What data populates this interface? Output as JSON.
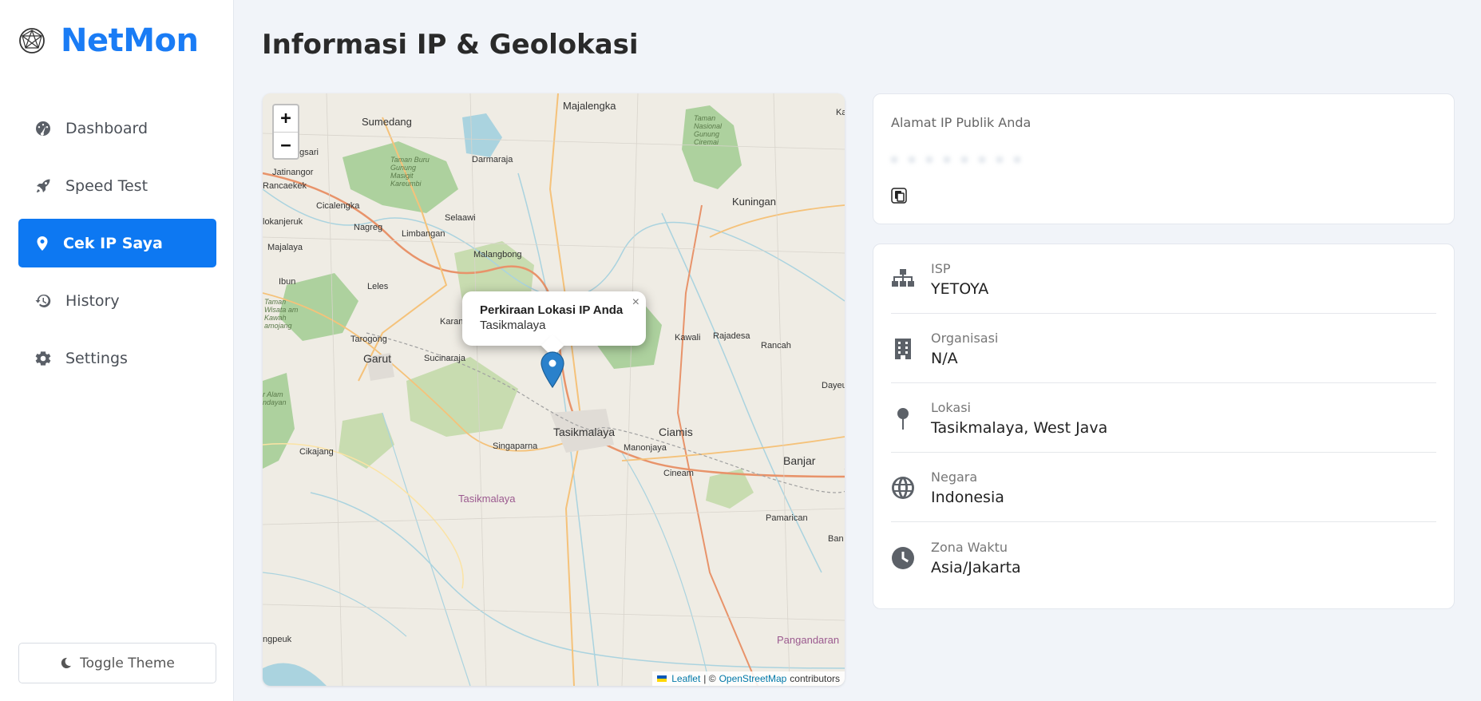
{
  "brand": {
    "name": "NetMon",
    "icon": "globe-network-icon",
    "accent": "#1a7cf5"
  },
  "sidebar": {
    "items": [
      {
        "label": "Dashboard",
        "icon": "gauge-icon",
        "active": false
      },
      {
        "label": "Speed Test",
        "icon": "rocket-icon",
        "active": false
      },
      {
        "label": "Cek IP Saya",
        "icon": "map-pin-icon",
        "active": true
      },
      {
        "label": "History",
        "icon": "history-icon",
        "active": false
      },
      {
        "label": "Settings",
        "icon": "gear-icon",
        "active": false
      }
    ],
    "toggle_label": "Toggle Theme",
    "active_color": "#0d78f2"
  },
  "page": {
    "title": "Informasi IP & Geolokasi"
  },
  "map": {
    "zoom_in": "+",
    "zoom_out": "−",
    "popup": {
      "title": "Perkiraan Lokasi IP Anda",
      "subtitle": "Tasikmalaya",
      "close": "×"
    },
    "attribution": {
      "leaflet": "Leaflet",
      "sep": "| ©",
      "osm": "OpenStreetMap",
      "suffix": "contributors"
    },
    "labels": {
      "majalengka": "Majalengka",
      "sumedang": "Sumedang",
      "darmaraja": "Darmaraja",
      "kuningan": "Kuningan",
      "taman_nasional": "Taman Nasional Gunung Ciremai",
      "taman_buru": "Taman Buru Gunung Masigit Kareumbi",
      "jatinangor": "Jatinangor",
      "rancaekek": "Rancaekek",
      "cicalengka": "Cicalengka",
      "nagreg": "Nagreg",
      "limbangan": "Limbangan",
      "selaawi": "Selaawi",
      "malangbong": "Malangbong",
      "lokanjeruk": "lokanjeruk",
      "majalaya": "Majalaya",
      "ibun": "Ibun",
      "leles": "Leles",
      "taman_wisata": "Taman Wisata am Kawah amojang",
      "tarogong": "Tarogong",
      "garut": "Garut",
      "sucinaraja": "Sucinaraja",
      "karan": "Karan",
      "kawali": "Kawali",
      "rajadesa": "Rajadesa",
      "rancah": "Rancah",
      "dayeu": "Dayeu",
      "tasikmalaya_city": "Tasikmalaya",
      "ciamis": "Ciamis",
      "manonjaya": "Manonjaya",
      "singaparna": "Singaparna",
      "cikajang": "Cikajang",
      "banjar": "Banjar",
      "cineam": "Cineam",
      "tasikmalaya_region": "Tasikmalaya",
      "pamarican": "Pamarican",
      "ban": "Ban",
      "ngpeuk": "ngpeuk",
      "pangandaran": "Pangandaran",
      "cr_alam": "r Alam ndayan",
      "ngsari": "ngsari",
      "ka": "Ka"
    }
  },
  "ip_card": {
    "label": "Alamat IP Publik Anda",
    "copy_icon": "copy-icon"
  },
  "info": [
    {
      "label": "ISP",
      "value": "YETOYA",
      "icon": "network-icon"
    },
    {
      "label": "Organisasi",
      "value": "N/A",
      "icon": "building-icon"
    },
    {
      "label": "Lokasi",
      "value": "Tasikmalaya, West Java",
      "icon": "map-pin-icon"
    },
    {
      "label": "Negara",
      "value": "Indonesia",
      "icon": "globe-icon"
    },
    {
      "label": "Zona Waktu",
      "value": "Asia/Jakarta",
      "icon": "clock-icon"
    }
  ]
}
